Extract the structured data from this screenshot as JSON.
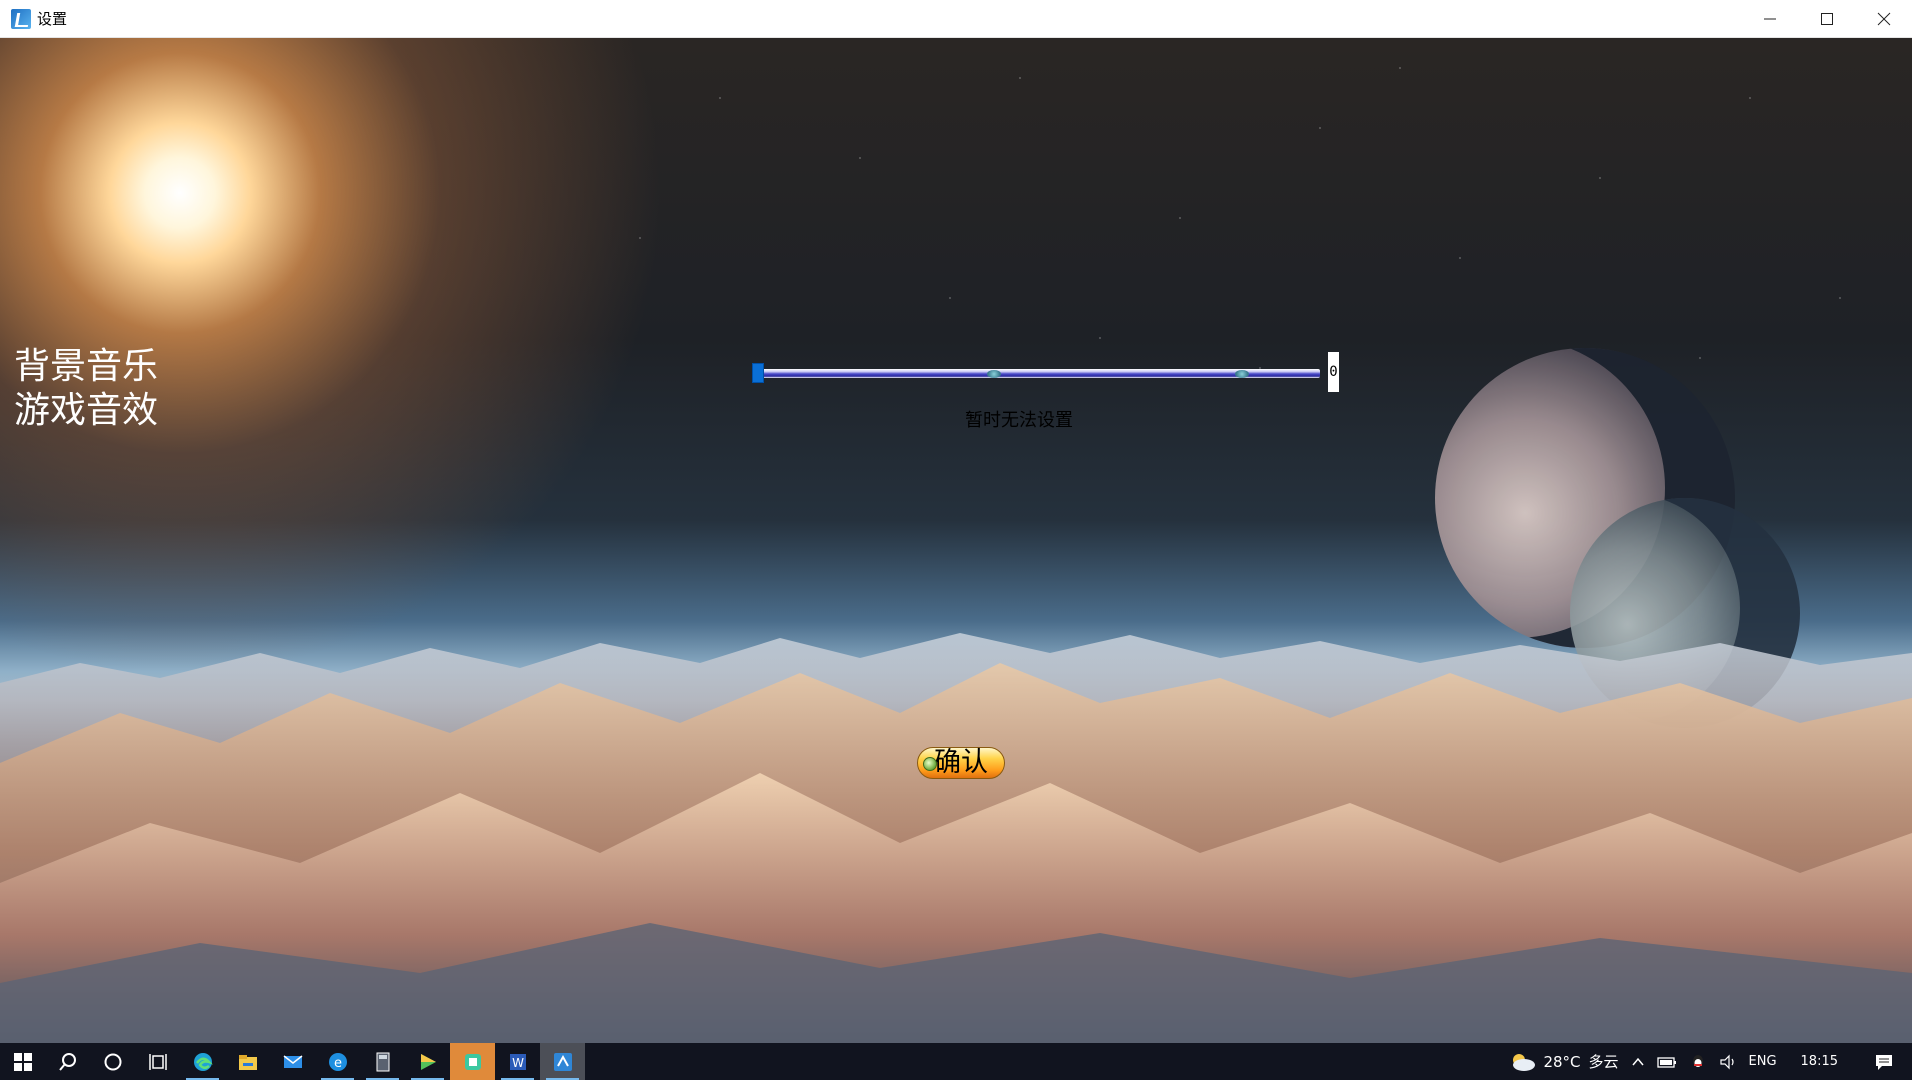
{
  "window": {
    "title": "设置",
    "icon": "app-icon",
    "controls": [
      "minimize-icon",
      "maximize-icon",
      "close-icon"
    ]
  },
  "settings": {
    "labels": [
      "背景音乐",
      "游戏音效"
    ],
    "slider": {
      "value": "0",
      "fill_fraction": 0
    },
    "unavailable_text": "暂时无法设置",
    "confirm_label": "确认"
  },
  "colors": {
    "slider_thumb": "#0a6fd6",
    "confirm_button": "#ff9c1a",
    "taskbar_highlight": "#e08a3a"
  },
  "taskbar": {
    "apps": [
      {
        "name": "start-icon"
      },
      {
        "name": "search-icon"
      },
      {
        "name": "cortana-icon"
      },
      {
        "name": "task-view-icon"
      },
      {
        "name": "edge-icon"
      },
      {
        "name": "file-explorer-icon"
      },
      {
        "name": "mail-icon"
      },
      {
        "name": "ie-icon"
      },
      {
        "name": "calculator-icon"
      },
      {
        "name": "media-player-icon"
      },
      {
        "name": "app-green-icon"
      },
      {
        "name": "word-icon"
      },
      {
        "name": "settings-app-icon"
      }
    ],
    "weather": {
      "temp": "28°C",
      "desc": "多云"
    },
    "language": "ENG",
    "time": "18:15"
  }
}
